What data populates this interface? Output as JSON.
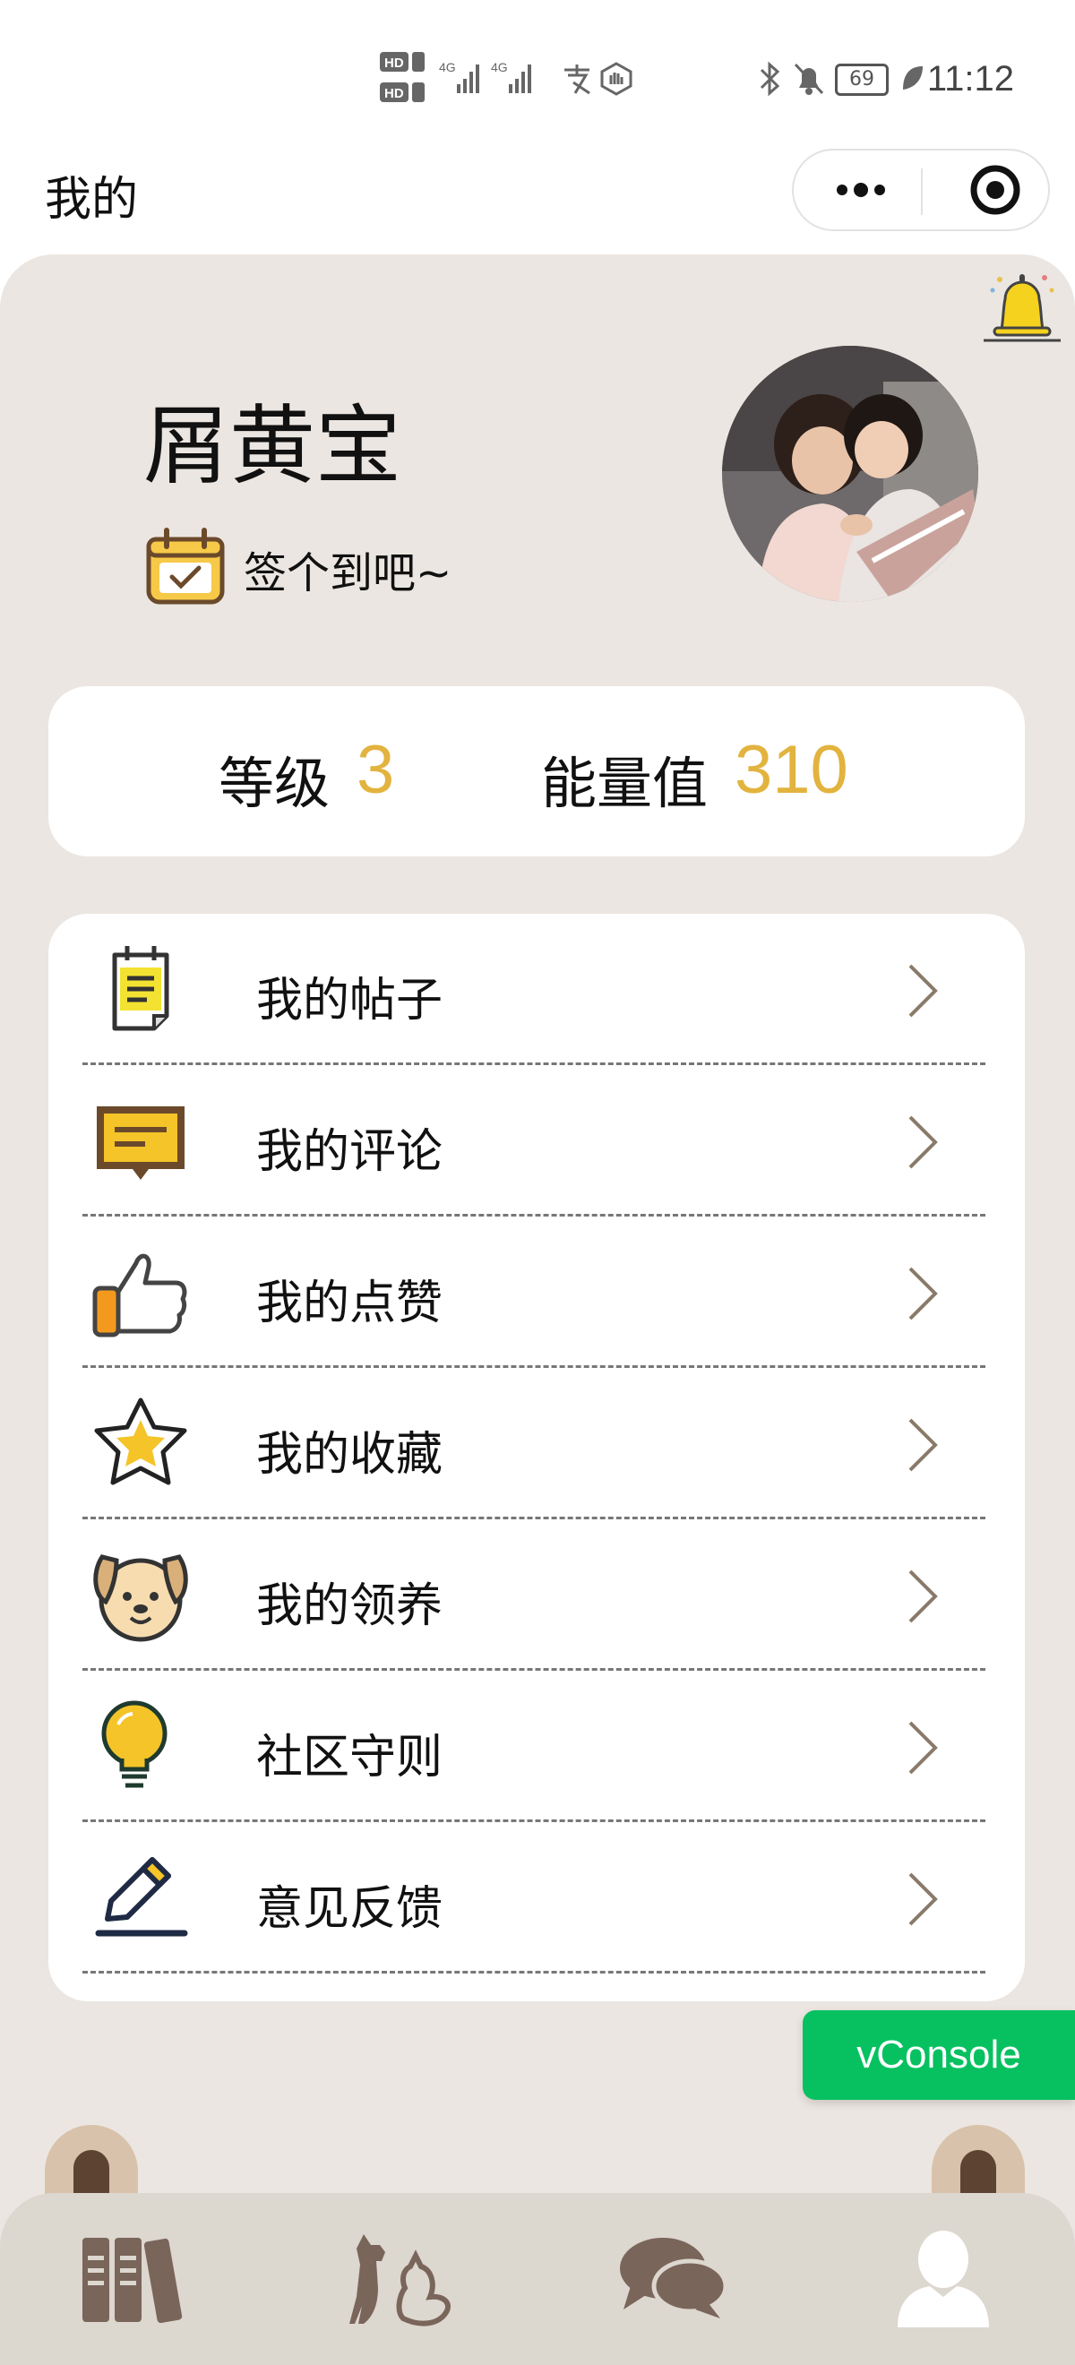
{
  "status_bar": {
    "hd_left": "HD",
    "net_1": "4G",
    "net_2": "4G",
    "battery": "69",
    "time": "11:12"
  },
  "nav": {
    "title": "我的"
  },
  "profile": {
    "name": "屑黄宝",
    "checkin_label": "签个到吧~"
  },
  "stats": {
    "level_label": "等级",
    "level_value": "3",
    "energy_label": "能量值",
    "energy_value": "310"
  },
  "menu": {
    "items": [
      {
        "label": "我的帖子",
        "icon": "notepad-icon"
      },
      {
        "label": "我的评论",
        "icon": "comment-icon"
      },
      {
        "label": "我的点赞",
        "icon": "thumbs-up-icon"
      },
      {
        "label": "我的收藏",
        "icon": "star-icon"
      },
      {
        "label": "我的领养",
        "icon": "dog-icon"
      },
      {
        "label": "社区守则",
        "icon": "lightbulb-icon"
      },
      {
        "label": "意见反馈",
        "icon": "pencil-icon"
      }
    ]
  },
  "vconsole": {
    "label": "vConsole"
  },
  "tabbar": {
    "tabs": [
      {
        "icon": "books-icon"
      },
      {
        "icon": "pets-icon"
      },
      {
        "icon": "chat-icon"
      },
      {
        "icon": "user-icon",
        "active": true
      }
    ]
  },
  "colors": {
    "accent": "#e2b33e",
    "page_bg": "#ebe6e1",
    "tabbar_bg": "#dcd7cf",
    "vconsole": "#07c160"
  }
}
